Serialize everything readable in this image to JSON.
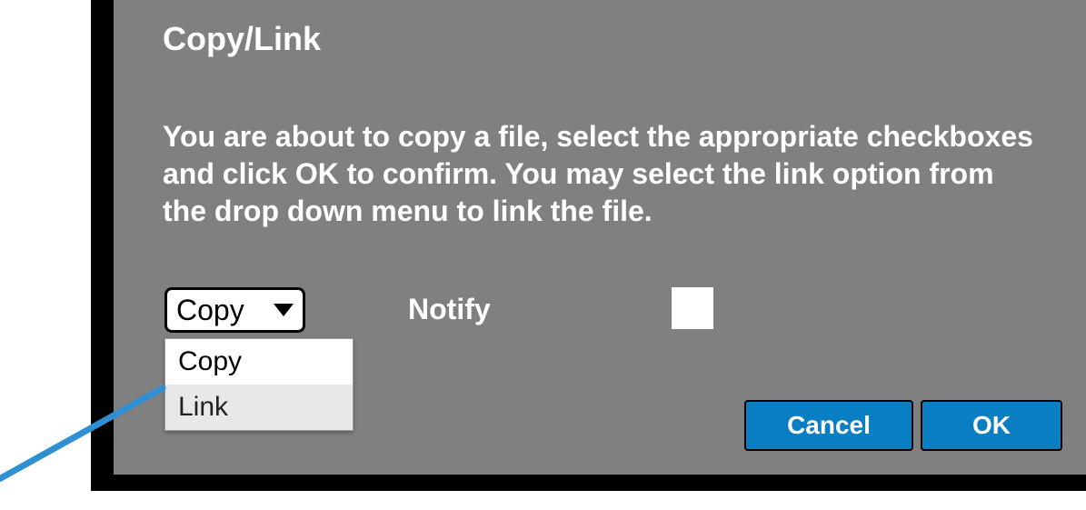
{
  "dialog": {
    "title": "Copy/Link",
    "body": "You are about to copy a file, select the appropriate checkboxes and click OK to confirm. You may select the link option from the drop down menu to link the file."
  },
  "dropdown": {
    "selected": "Copy",
    "options": [
      "Copy",
      "Link"
    ]
  },
  "notify": {
    "label": "Notify",
    "checked": false
  },
  "buttons": {
    "cancel": "Cancel",
    "ok": "OK"
  }
}
